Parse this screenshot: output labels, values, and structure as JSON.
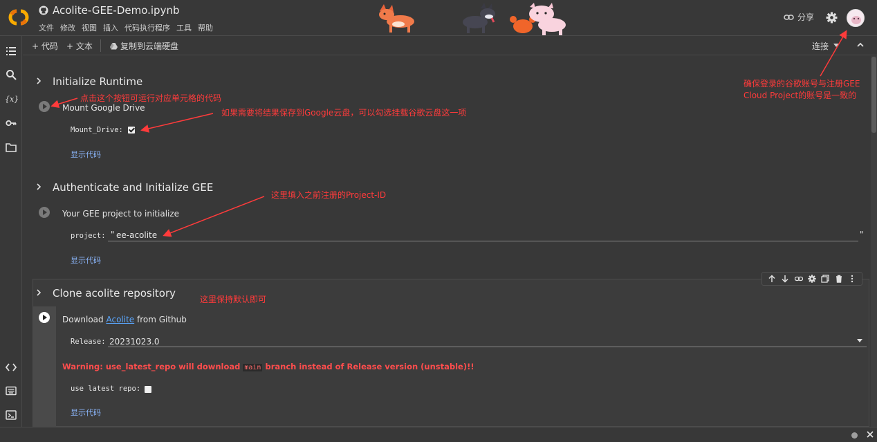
{
  "header": {
    "doc_title": "Acolite-GEE-Demo.ipynb",
    "menu": [
      "文件",
      "修改",
      "视图",
      "插入",
      "代码执行程序",
      "工具",
      "帮助"
    ],
    "share_label": "分享"
  },
  "toolbar": {
    "add_code": "+ 代码",
    "add_text": "+ 文本",
    "copy_drive": "复制到云端硬盘",
    "connect": "连接"
  },
  "sections": [
    {
      "title": "Initialize Runtime",
      "cell_title": "Mount Google Drive",
      "param_label": "Mount_Drive:",
      "param_checked": true,
      "show_code": "显示代码"
    },
    {
      "title": "Authenticate and Initialize GEE",
      "cell_title": "Your GEE project to initialize",
      "param_label": "project:",
      "param_value": "ee-acolite",
      "quote_open": "\"",
      "quote_close": "\"",
      "show_code": "显示代码"
    },
    {
      "title": "Clone acolite repository",
      "cell_title_pre": "Download ",
      "cell_title_link": "Acolite",
      "cell_title_post": " from Github",
      "release_label": "Release:",
      "release_value": "20231023.0",
      "warning_pre": "Warning: use_latest_repo will download ",
      "warning_code": "main",
      "warning_post": " branch instead of Release version (unstable)!!",
      "latest_label": "use latest repo:",
      "latest_checked": false,
      "show_code": "显示代码"
    }
  ],
  "annotations": {
    "run_button": "点击这个按钮可运行对应单元格的代码",
    "mount_drive": "如果需要将结果保存到Google云盘，可以勾选挂载谷歌云盘这一项",
    "project_id": "这里填入之前注册的Project-ID",
    "keep_default": "这里保持默认即可",
    "account_line1": "确保登录的谷歌账号与注册GEE",
    "account_line2": "Cloud Project的账号是一致的",
    "color": "#ff3b3b"
  },
  "icons": {
    "rail": [
      "toc-icon",
      "search-icon",
      "variables-icon",
      "key-icon",
      "folder-icon",
      "code-snippets-icon",
      "command-palette-icon",
      "terminal-icon"
    ],
    "cell_toolbar": [
      "arrow-up-icon",
      "arrow-down-icon",
      "link-icon",
      "gear-icon",
      "mirror-cell-icon",
      "trash-icon",
      "more-vert-icon"
    ]
  }
}
